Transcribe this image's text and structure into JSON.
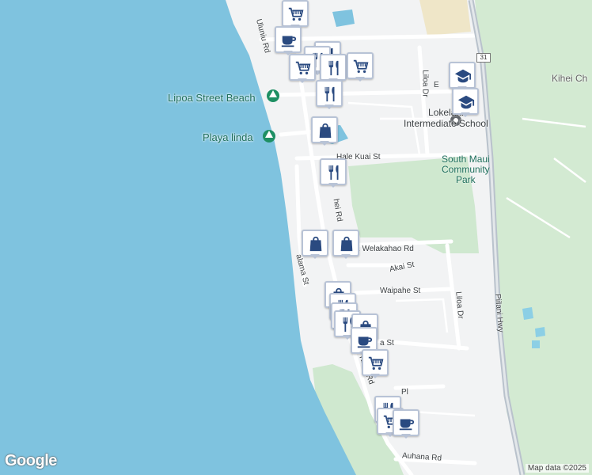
{
  "map": {
    "colors": {
      "water": "#7fc3df",
      "land": "#f2f3f4",
      "park": "#cfe8cf",
      "road": "#ffffff",
      "highway": "#b9c2cc",
      "marker_border": "#b8c3d6",
      "icon": "#2a4a80"
    },
    "places": {
      "lipoa_beach": "Lipoa Street Beach",
      "playa_linda": "Playa linda",
      "school_line1": "Lokelani",
      "school_line2": "Intermediate School",
      "park_line1": "South Maui",
      "park_line2": "Community",
      "park_line3": "Park",
      "kihei_ch": "Kihei Ch"
    },
    "streets": {
      "uluniu": "Uluniu Rd",
      "hale_kuai": "Hale Kuai St",
      "liloa_top": "Liloa Dr",
      "liloa_bottom": "Liloa Dr",
      "kihei_upper": "hei Rd",
      "kihei_lower": "Kihei Rd",
      "welakahao": "E Welakahao Rd",
      "akai": "Akai St",
      "waipahe": "Waipahe St",
      "kalama": "alama St",
      "piilani": "Piilani Hwy",
      "auhana": "Auhana Rd",
      "e_partial": "E",
      "st_partial": "a St",
      "pl_partial": "Pl"
    },
    "route_shield": "31",
    "markers": [
      {
        "type": "grocery-icon"
      },
      {
        "type": "cafe-icon"
      },
      {
        "type": "restaurant-icon"
      },
      {
        "type": "restaurant-icon"
      },
      {
        "type": "grocery-icon"
      },
      {
        "type": "restaurant-icon"
      },
      {
        "type": "grocery-icon"
      },
      {
        "type": "restaurant-icon"
      },
      {
        "type": "school-icon"
      },
      {
        "type": "school-icon"
      },
      {
        "type": "shopping-bag-icon"
      },
      {
        "type": "restaurant-icon"
      },
      {
        "type": "shopping-bag-icon"
      },
      {
        "type": "shopping-bag-icon"
      },
      {
        "type": "shopping-bag-icon"
      },
      {
        "type": "restaurant-icon"
      },
      {
        "type": "restaurant-icon"
      },
      {
        "type": "restaurant-icon"
      },
      {
        "type": "shopping-bag-icon"
      },
      {
        "type": "cafe-icon"
      },
      {
        "type": "grocery-icon"
      },
      {
        "type": "restaurant-icon"
      },
      {
        "type": "grocery-icon"
      },
      {
        "type": "cafe-icon"
      }
    ]
  },
  "footer": {
    "logo": "Google",
    "attribution": "Map data ©2025"
  }
}
